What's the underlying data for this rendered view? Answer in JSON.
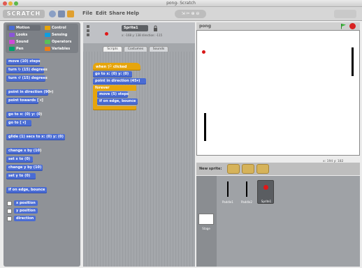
{
  "window": {
    "title": "pong- Scratch"
  },
  "menubar": {
    "logo": "SCRATCH",
    "menus": [
      "File",
      "Edit",
      "Share",
      "Help"
    ]
  },
  "palette": {
    "categories": [
      {
        "label": "Motion",
        "color": "#4a6cd4"
      },
      {
        "label": "Control",
        "color": "#e6a50c"
      },
      {
        "label": "Looks",
        "color": "#8a55d7"
      },
      {
        "label": "Sensing",
        "color": "#0e9ee0"
      },
      {
        "label": "Sound",
        "color": "#cf4ad9"
      },
      {
        "label": "Operators",
        "color": "#59c059"
      },
      {
        "label": "Pen",
        "color": "#00a16b"
      },
      {
        "label": "Variables",
        "color": "#ee7d16"
      }
    ],
    "blocks": [
      "move (10) steps",
      "turn ↻ (15) degrees",
      "turn ↺ (15) degrees",
      "point in direction (90▾)",
      "point towards [ ▾]",
      "go to x: (0) y: (0)",
      "go to [ ▾]",
      "glide (1) secs to x: (0) y: (0)",
      "change x by (10)",
      "set x to (0)",
      "change y by (10)",
      "set y to (0)",
      "if on edge, bounce"
    ],
    "reporters": [
      "x position",
      "y position",
      "direction"
    ]
  },
  "sprite": {
    "name": "Sprite1",
    "coords": "x: -168  y: 138  direction: -115",
    "tabs": [
      "Scripts",
      "Costumes",
      "Sounds"
    ]
  },
  "script": {
    "hat": "when 🏳 clicked",
    "blocks": [
      "go to x: (0) y: (0)",
      "point in direction (45▾)"
    ],
    "forever": "forever",
    "inner": [
      "move (5) steps",
      "if on edge, bounce"
    ]
  },
  "stage": {
    "name": "pong",
    "mouse": "x: 194   y: 182"
  },
  "new_sprite": {
    "label": "New sprite:"
  },
  "sprites": [
    {
      "name": "Paddle1"
    },
    {
      "name": "Paddle2"
    },
    {
      "name": "Sprite1"
    }
  ],
  "stage_thumb": {
    "label": "Stage"
  },
  "colors": {
    "motion": "#4a6cd4",
    "control": "#e6a50c",
    "ball": "#e01818"
  }
}
